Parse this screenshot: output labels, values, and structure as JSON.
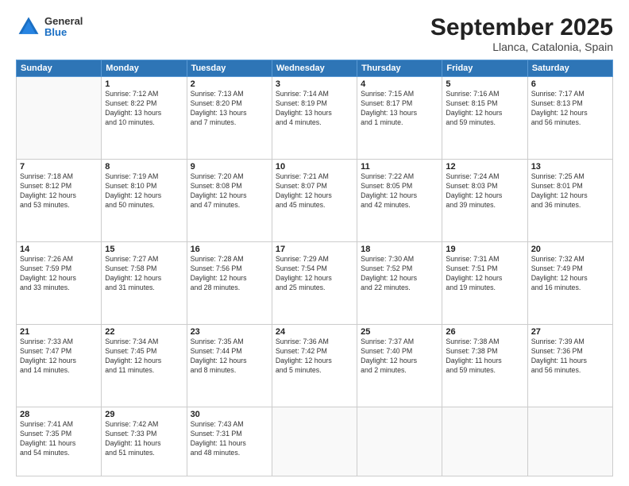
{
  "header": {
    "logo": {
      "line1": "General",
      "line2": "Blue"
    },
    "title": "September 2025",
    "subtitle": "Llanca, Catalonia, Spain"
  },
  "days_of_week": [
    "Sunday",
    "Monday",
    "Tuesday",
    "Wednesday",
    "Thursday",
    "Friday",
    "Saturday"
  ],
  "weeks": [
    [
      {
        "day": "",
        "info": ""
      },
      {
        "day": "1",
        "info": "Sunrise: 7:12 AM\nSunset: 8:22 PM\nDaylight: 13 hours\nand 10 minutes."
      },
      {
        "day": "2",
        "info": "Sunrise: 7:13 AM\nSunset: 8:20 PM\nDaylight: 13 hours\nand 7 minutes."
      },
      {
        "day": "3",
        "info": "Sunrise: 7:14 AM\nSunset: 8:19 PM\nDaylight: 13 hours\nand 4 minutes."
      },
      {
        "day": "4",
        "info": "Sunrise: 7:15 AM\nSunset: 8:17 PM\nDaylight: 13 hours\nand 1 minute."
      },
      {
        "day": "5",
        "info": "Sunrise: 7:16 AM\nSunset: 8:15 PM\nDaylight: 12 hours\nand 59 minutes."
      },
      {
        "day": "6",
        "info": "Sunrise: 7:17 AM\nSunset: 8:13 PM\nDaylight: 12 hours\nand 56 minutes."
      }
    ],
    [
      {
        "day": "7",
        "info": "Sunrise: 7:18 AM\nSunset: 8:12 PM\nDaylight: 12 hours\nand 53 minutes."
      },
      {
        "day": "8",
        "info": "Sunrise: 7:19 AM\nSunset: 8:10 PM\nDaylight: 12 hours\nand 50 minutes."
      },
      {
        "day": "9",
        "info": "Sunrise: 7:20 AM\nSunset: 8:08 PM\nDaylight: 12 hours\nand 47 minutes."
      },
      {
        "day": "10",
        "info": "Sunrise: 7:21 AM\nSunset: 8:07 PM\nDaylight: 12 hours\nand 45 minutes."
      },
      {
        "day": "11",
        "info": "Sunrise: 7:22 AM\nSunset: 8:05 PM\nDaylight: 12 hours\nand 42 minutes."
      },
      {
        "day": "12",
        "info": "Sunrise: 7:24 AM\nSunset: 8:03 PM\nDaylight: 12 hours\nand 39 minutes."
      },
      {
        "day": "13",
        "info": "Sunrise: 7:25 AM\nSunset: 8:01 PM\nDaylight: 12 hours\nand 36 minutes."
      }
    ],
    [
      {
        "day": "14",
        "info": "Sunrise: 7:26 AM\nSunset: 7:59 PM\nDaylight: 12 hours\nand 33 minutes."
      },
      {
        "day": "15",
        "info": "Sunrise: 7:27 AM\nSunset: 7:58 PM\nDaylight: 12 hours\nand 31 minutes."
      },
      {
        "day": "16",
        "info": "Sunrise: 7:28 AM\nSunset: 7:56 PM\nDaylight: 12 hours\nand 28 minutes."
      },
      {
        "day": "17",
        "info": "Sunrise: 7:29 AM\nSunset: 7:54 PM\nDaylight: 12 hours\nand 25 minutes."
      },
      {
        "day": "18",
        "info": "Sunrise: 7:30 AM\nSunset: 7:52 PM\nDaylight: 12 hours\nand 22 minutes."
      },
      {
        "day": "19",
        "info": "Sunrise: 7:31 AM\nSunset: 7:51 PM\nDaylight: 12 hours\nand 19 minutes."
      },
      {
        "day": "20",
        "info": "Sunrise: 7:32 AM\nSunset: 7:49 PM\nDaylight: 12 hours\nand 16 minutes."
      }
    ],
    [
      {
        "day": "21",
        "info": "Sunrise: 7:33 AM\nSunset: 7:47 PM\nDaylight: 12 hours\nand 14 minutes."
      },
      {
        "day": "22",
        "info": "Sunrise: 7:34 AM\nSunset: 7:45 PM\nDaylight: 12 hours\nand 11 minutes."
      },
      {
        "day": "23",
        "info": "Sunrise: 7:35 AM\nSunset: 7:44 PM\nDaylight: 12 hours\nand 8 minutes."
      },
      {
        "day": "24",
        "info": "Sunrise: 7:36 AM\nSunset: 7:42 PM\nDaylight: 12 hours\nand 5 minutes."
      },
      {
        "day": "25",
        "info": "Sunrise: 7:37 AM\nSunset: 7:40 PM\nDaylight: 12 hours\nand 2 minutes."
      },
      {
        "day": "26",
        "info": "Sunrise: 7:38 AM\nSunset: 7:38 PM\nDaylight: 11 hours\nand 59 minutes."
      },
      {
        "day": "27",
        "info": "Sunrise: 7:39 AM\nSunset: 7:36 PM\nDaylight: 11 hours\nand 56 minutes."
      }
    ],
    [
      {
        "day": "28",
        "info": "Sunrise: 7:41 AM\nSunset: 7:35 PM\nDaylight: 11 hours\nand 54 minutes."
      },
      {
        "day": "29",
        "info": "Sunrise: 7:42 AM\nSunset: 7:33 PM\nDaylight: 11 hours\nand 51 minutes."
      },
      {
        "day": "30",
        "info": "Sunrise: 7:43 AM\nSunset: 7:31 PM\nDaylight: 11 hours\nand 48 minutes."
      },
      {
        "day": "",
        "info": ""
      },
      {
        "day": "",
        "info": ""
      },
      {
        "day": "",
        "info": ""
      },
      {
        "day": "",
        "info": ""
      }
    ]
  ]
}
